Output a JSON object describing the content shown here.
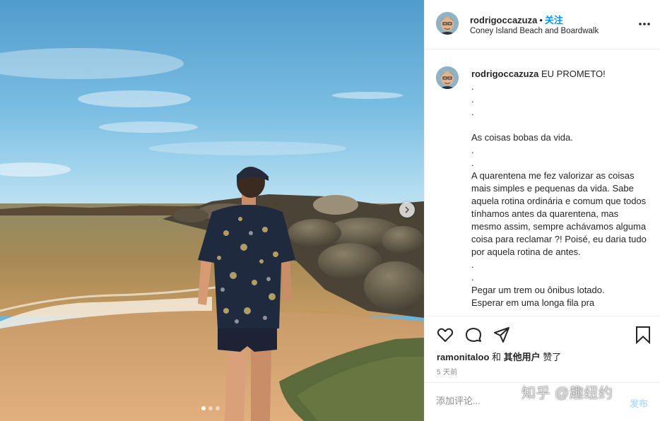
{
  "post": {
    "username": "rodrigoccazuza",
    "separator": "•",
    "follow_label": "关注",
    "location": "Coney Island Beach and Boardwalk"
  },
  "caption": {
    "username": "rodrigoccazuza",
    "text": " EU PROMETO!\n.\n.\n.\n\nAs coisas bobas da vida.\n.\n.\nA quarentena me fez valorizar as coisas mais simples e pequenas da vida. Sabe aquela rotina ordinária e comum que todos tínhamos antes da quarentena, mas mesmo assim, sempre achávamos alguma coisa para reclamar ?! Poisé, eu daria tudo por aquela rotina de antes.\n.\n.\nPegar um trem ou ônibus lotado.\nEsperar em uma longa fila pra"
  },
  "likes": {
    "user": "ramonitaloo",
    "and": " 和 ",
    "others": "其他用户",
    "suffix": " 赞了"
  },
  "time_ago": "5 天前",
  "comment": {
    "placeholder": "添加评论...",
    "post_label": "发布"
  },
  "carousel": {
    "total": 3,
    "current": 1
  },
  "icons": {
    "more": "more-options-icon",
    "like": "heart-icon",
    "comment": "comment-icon",
    "share": "share-icon",
    "save": "bookmark-icon",
    "next": "chevron-right-icon"
  },
  "colors": {
    "accent": "#0095f6",
    "post_disabled": "#b2dffc",
    "muted": "#8e8e8e"
  },
  "watermark": "知乎 @趣纽约"
}
